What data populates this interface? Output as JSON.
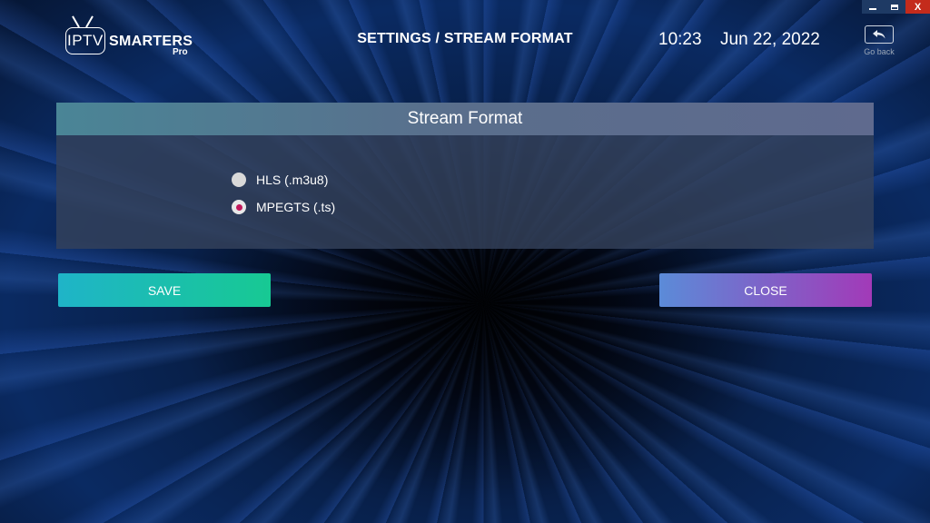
{
  "window_controls": {
    "minimize_icon": "minimize-icon",
    "maximize_icon": "maximize-icon",
    "close_label": "X"
  },
  "header": {
    "logo": {
      "iptv": "IPTV",
      "smarters": "SMARTERS",
      "pro": "Pro"
    },
    "title": "SETTINGS / STREAM FORMAT",
    "time": "10:23",
    "date": "Jun 22, 2022",
    "go_back_label": "Go back"
  },
  "panel": {
    "title": "Stream Format",
    "options": [
      {
        "label": "HLS (.m3u8)",
        "selected": false
      },
      {
        "label": "MPEGTS (.ts)",
        "selected": true
      }
    ]
  },
  "buttons": {
    "save_label": "SAVE",
    "close_label": "CLOSE"
  },
  "colors": {
    "save_gradient": [
      "#1fb4c8",
      "#17c993"
    ],
    "close_gradient": [
      "#5b8bd8",
      "#a23ab8"
    ],
    "radio_selected_dot": "#c2185b"
  }
}
